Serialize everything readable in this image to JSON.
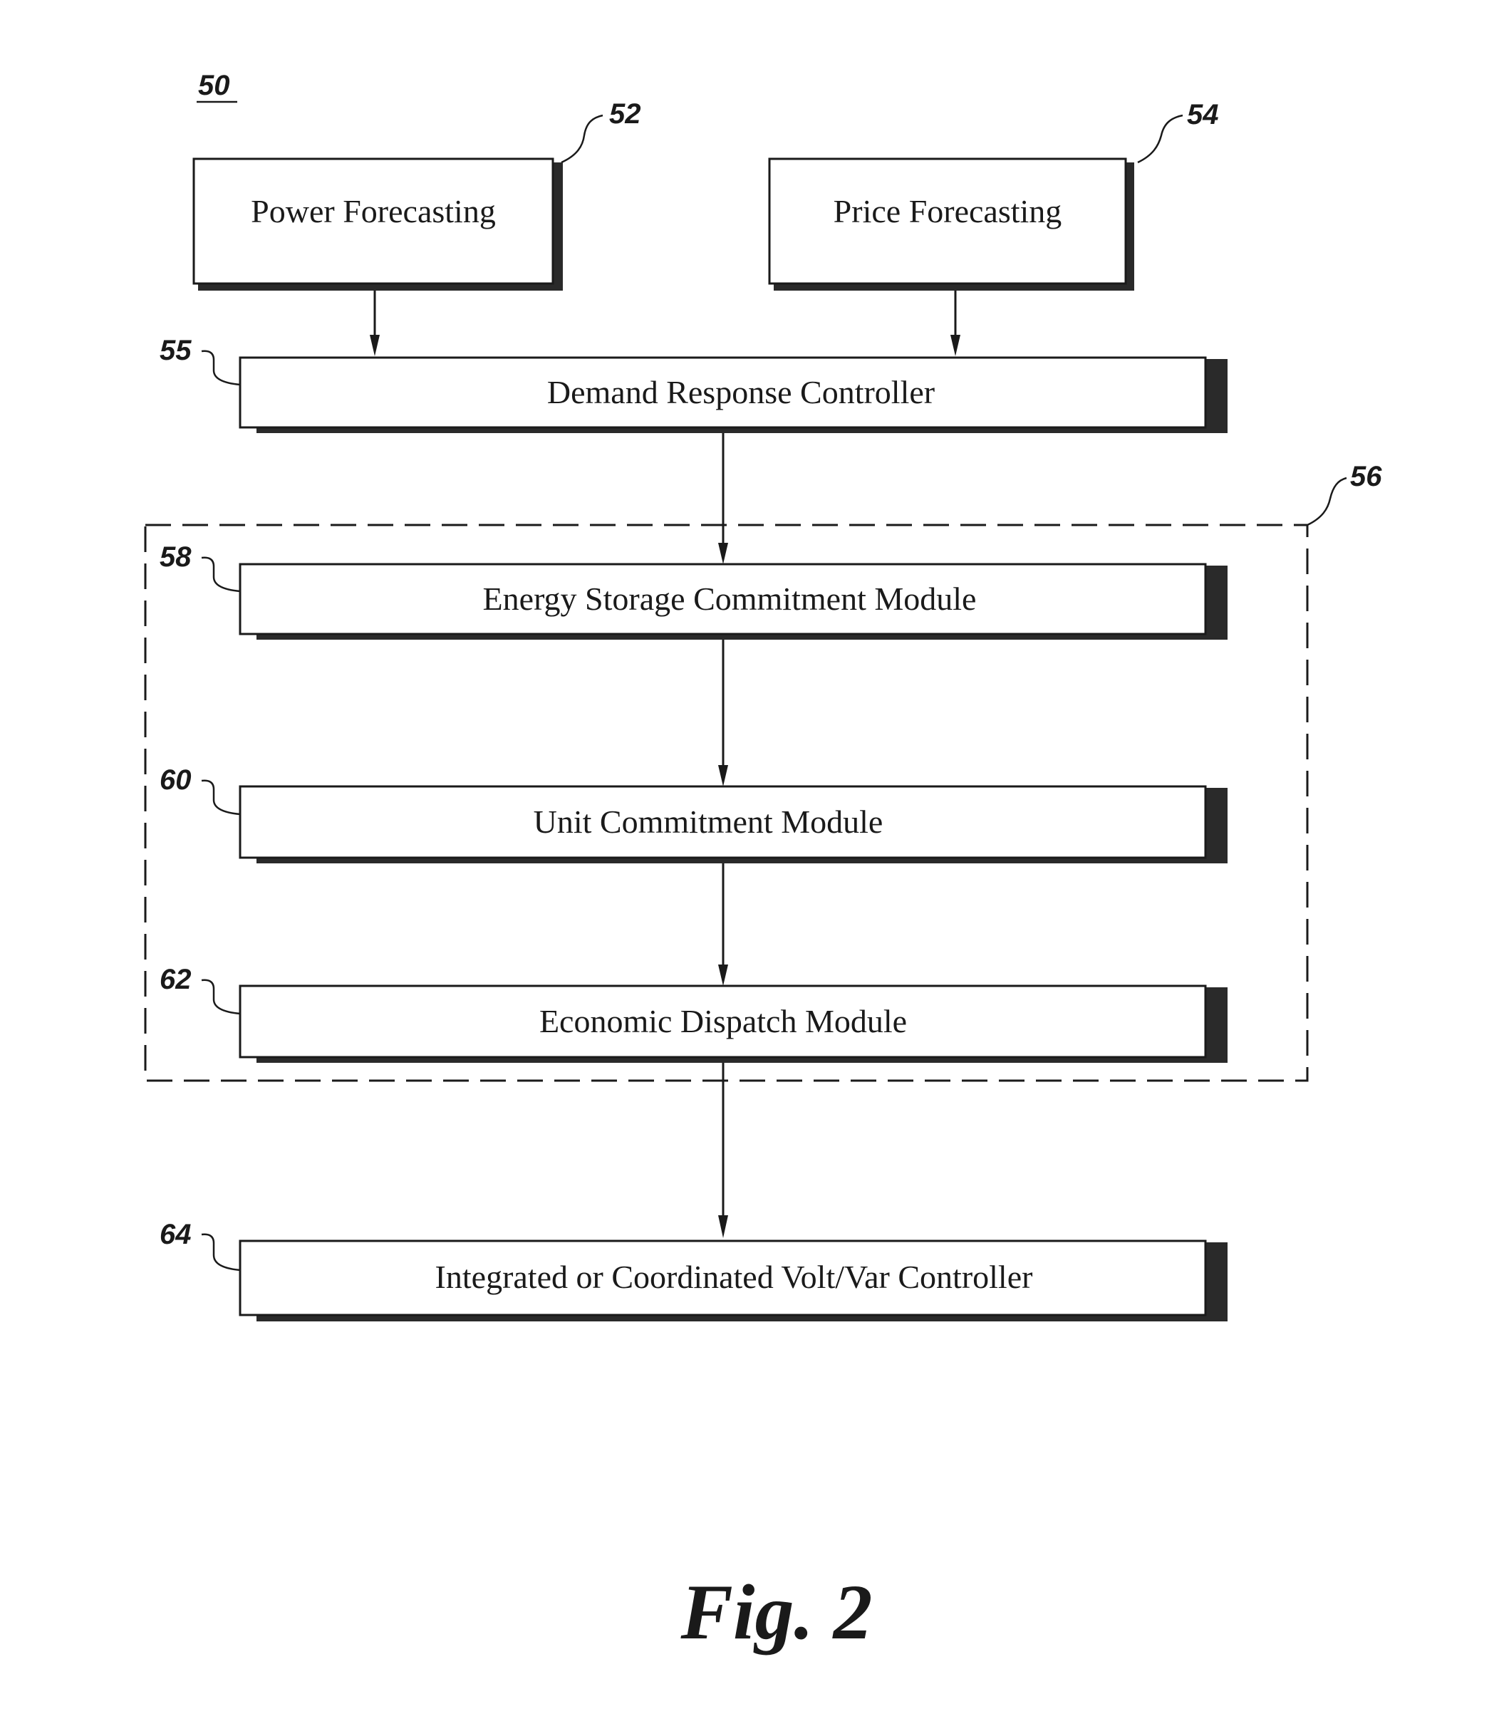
{
  "figure": {
    "reference": "50",
    "caption": "Fig. 2"
  },
  "top_blocks": [
    {
      "ref": "52",
      "label": "Power Forecasting"
    },
    {
      "ref": "54",
      "label": "Price Forecasting"
    }
  ],
  "demand_controller": {
    "ref": "55",
    "label": "Demand Response Controller"
  },
  "group": {
    "ref": "56",
    "modules": [
      {
        "ref": "58",
        "label": "Energy Storage Commitment Module"
      },
      {
        "ref": "60",
        "label": "Unit Commitment Module"
      },
      {
        "ref": "62",
        "label": "Economic Dispatch Module"
      }
    ]
  },
  "volt_var_controller": {
    "ref": "64",
    "label": "Integrated or Coordinated Volt/Var Controller"
  },
  "colors": {
    "ink": "#1a1a1a",
    "background": "#ffffff"
  }
}
